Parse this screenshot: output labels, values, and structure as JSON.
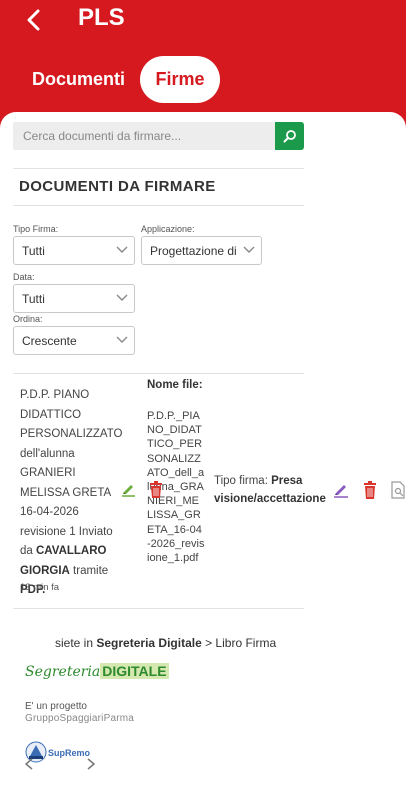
{
  "header": {
    "title": "PLS",
    "tabs": [
      {
        "label": "Documenti",
        "active": false
      },
      {
        "label": "Firme",
        "active": true
      }
    ]
  },
  "search": {
    "placeholder": "Cerca documenti da firmare...",
    "value": ""
  },
  "section_title": "DOCUMENTI DA FIRMARE",
  "filters": {
    "tipo_firma": {
      "label": "Tipo Firma:",
      "value": "Tutti"
    },
    "applicazione": {
      "label": "Applicazione:",
      "value": "Progettazione di"
    },
    "data": {
      "label": "Data:",
      "value": "Tutti"
    },
    "ordina": {
      "label": "Ordina:",
      "value": "Crescente"
    }
  },
  "documents": [
    {
      "desc_1": "P.D.P. PIANO DIDATTICO PERSONALIZZATO dell'alunna GRANIERI MELISSA GRETA 16-04-2026 revisione 1 Inviato da",
      "sender": "CAVALLARO GIORGIA",
      "via_word": "tramite",
      "via": "PDP.",
      "time": "13 min fa",
      "file_label": "Nome file:",
      "file_name": "P.D.P._PIANO_DIDATTICO_PERSONALIZZATO_dell_alunna_GRANIERI_MELISSA_GRETA_16-04-2026_revisione_1.pdf",
      "tipo_label": "Tipo firma:",
      "tipo_value": "Presa visione/accettazione"
    }
  ],
  "footer": {
    "prefix": "siete in",
    "location": "Segreteria Digitale",
    "suffix": "> Libro Firma",
    "logo_script": "Segreteria",
    "logo_bold": "DIGITALE",
    "project_line": "E' un progetto",
    "company": "GruppoSpaggiariParma",
    "supremo": "SupRemo"
  },
  "icons": [
    "back-arrow-icon",
    "search-icon",
    "chevron-down-icon",
    "sign-pen-icon",
    "trash-icon",
    "document-preview-icon"
  ],
  "colors": {
    "brand_red": "#d6181f",
    "search_green": "#1a9a4a",
    "sign_green": "#6aab3a",
    "sign_purple": "#8a5bbf",
    "trash_red": "#d9362f"
  }
}
